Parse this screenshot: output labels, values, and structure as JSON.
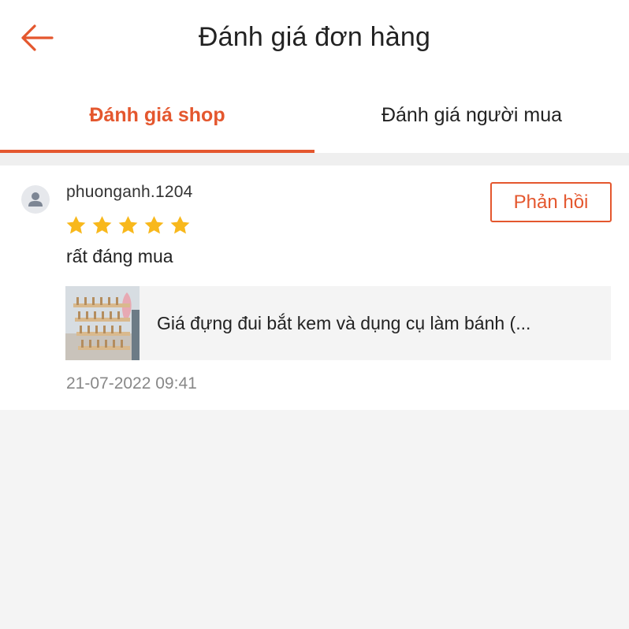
{
  "header": {
    "title": "Đánh giá đơn hàng",
    "back_icon": "arrow-left-icon",
    "accent_color": "#e4572e"
  },
  "tabs": [
    {
      "label": "Đánh giá shop",
      "active": true
    },
    {
      "label": "Đánh giá người mua",
      "active": false
    }
  ],
  "review": {
    "username": "phuonganh.1204",
    "avatar_icon": "user-avatar-icon",
    "rating": 5,
    "rating_max": 5,
    "star_color": "#f8b81c",
    "comment": "rất đáng mua",
    "reply_label": "Phản hồi",
    "product": {
      "name": "Giá đựng đui bắt kem và dụng cụ làm bánh (..."
    },
    "timestamp": "21-07-2022 09:41"
  }
}
